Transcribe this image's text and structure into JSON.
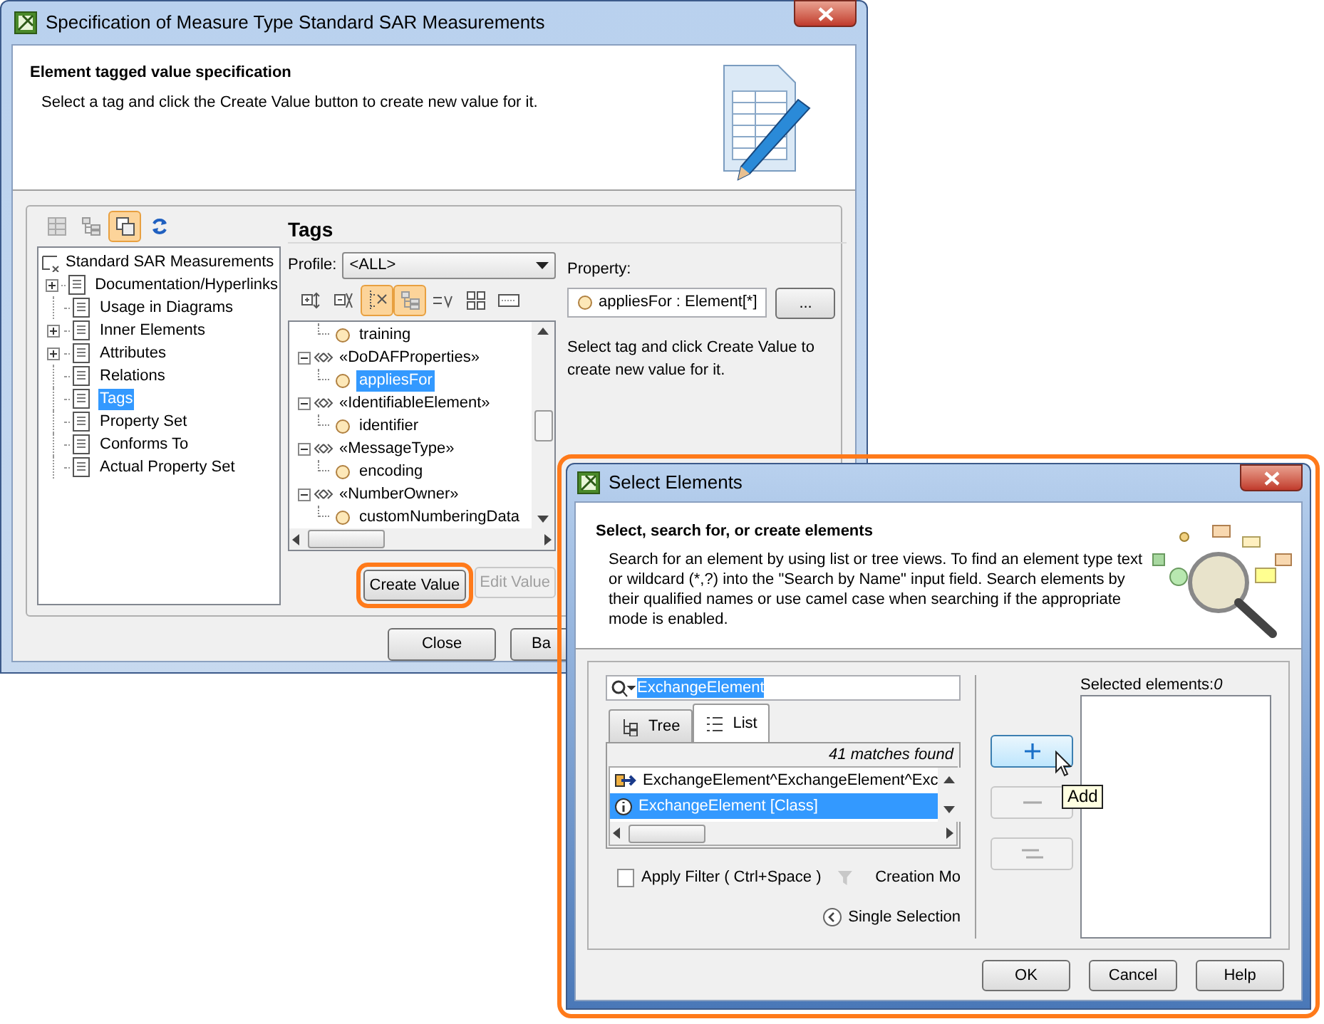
{
  "main_window": {
    "title": "Specification of Measure Type Standard SAR Measurements",
    "header": {
      "title": "Element tagged value specification",
      "description": "Select a tag and click the Create Value button to create new value for it."
    },
    "toolbar": [
      {
        "kind": "table",
        "on": false
      },
      {
        "kind": "tree",
        "on": false
      },
      {
        "kind": "copy",
        "on": true
      },
      {
        "kind": "refresh",
        "on": false
      }
    ],
    "tree": {
      "label": "Standard SAR Measurements",
      "children": [
        {
          "label": "Documentation/Hyperlinks",
          "expandable": true,
          "selected": false
        },
        {
          "label": "Usage in Diagrams",
          "expandable": false,
          "selected": false
        },
        {
          "label": "Inner Elements",
          "expandable": true,
          "selected": false
        },
        {
          "label": "Attributes",
          "expandable": true,
          "selected": false
        },
        {
          "label": "Relations",
          "expandable": false,
          "selected": false
        },
        {
          "label": "Tags",
          "expandable": false,
          "selected": true
        },
        {
          "label": "Property Set",
          "expandable": false,
          "selected": false
        },
        {
          "label": "Conforms To",
          "expandable": false,
          "selected": false
        },
        {
          "label": "Actual Property Set",
          "expandable": false,
          "selected": false
        }
      ]
    },
    "tags": {
      "title": "Tags",
      "profile_label": "Profile:",
      "profile_value": "<ALL>",
      "toolbar": [
        {
          "kind": "expand",
          "on": false
        },
        {
          "kind": "collapse",
          "on": false
        },
        {
          "kind": "group",
          "on": true
        },
        {
          "kind": "tree",
          "on": true
        },
        {
          "kind": "equals",
          "on": false
        },
        {
          "kind": "grid",
          "on": false
        },
        {
          "kind": "field",
          "on": false
        }
      ],
      "tag_tree": [
        {
          "children": [
            {
              "label": "training",
              "selected": false
            }
          ]
        },
        {
          "label": "«DoDAFProperties»",
          "children": [
            {
              "label": "appliesFor",
              "selected": true
            }
          ]
        },
        {
          "label": "«IdentifiableElement»",
          "children": [
            {
              "label": "identifier",
              "selected": false
            }
          ]
        },
        {
          "label": "«MessageType»",
          "children": [
            {
              "label": "encoding",
              "selected": false
            }
          ]
        },
        {
          "label": "«NumberOwner»",
          "children": [
            {
              "label": "customNumberingData",
              "selected": false
            }
          ]
        }
      ],
      "create_button": {
        "label": "Create Value",
        "callout": true
      },
      "edit_button": {
        "label": "Edit Value",
        "disabled": true
      },
      "property_label": "Property:",
      "property_value": "appliesFor : Element[*]",
      "browse_button": "...",
      "hint": "Select tag and click Create Value to create new value for it."
    },
    "buttons": [
      "Close",
      "Ba"
    ]
  },
  "select_window": {
    "title": "Select Elements",
    "callout": true,
    "header": {
      "title": "Select, search for, or create elements",
      "description": "Search for an element by using list or tree views. To find an element type text or wildcard (*,?) into the \"Search by Name\" input field. Search elements by their qualified names or use camel case when searching if the appropriate mode is enabled."
    },
    "search": {
      "value": "ExchangeElement"
    },
    "tabs": [
      {
        "label": "Tree",
        "selected": false
      },
      {
        "label": "List",
        "selected": true
      }
    ],
    "match_count": "41 matches found",
    "results": [
      {
        "kind": "relation",
        "label": "ExchangeElement^ExchangeElement^Exc",
        "selected": false
      },
      {
        "kind": "class",
        "label": "ExchangeElement [Class]",
        "selected": true
      }
    ],
    "apply_filter": {
      "label": "Apply Filter ( Ctrl+Space )",
      "checked": false
    },
    "creation_mode": "Creation Mo",
    "single_selection": "Single Selection",
    "move_buttons": [
      {
        "kind": "add",
        "hovered": true
      },
      {
        "kind": "remove",
        "hovered": false
      },
      {
        "kind": "remove_all",
        "hovered": false
      }
    ],
    "tooltip": "Add",
    "selected_label": "Selected elements:",
    "selected_count": "0",
    "buttons": [
      "OK",
      "Cancel",
      "Help"
    ]
  }
}
